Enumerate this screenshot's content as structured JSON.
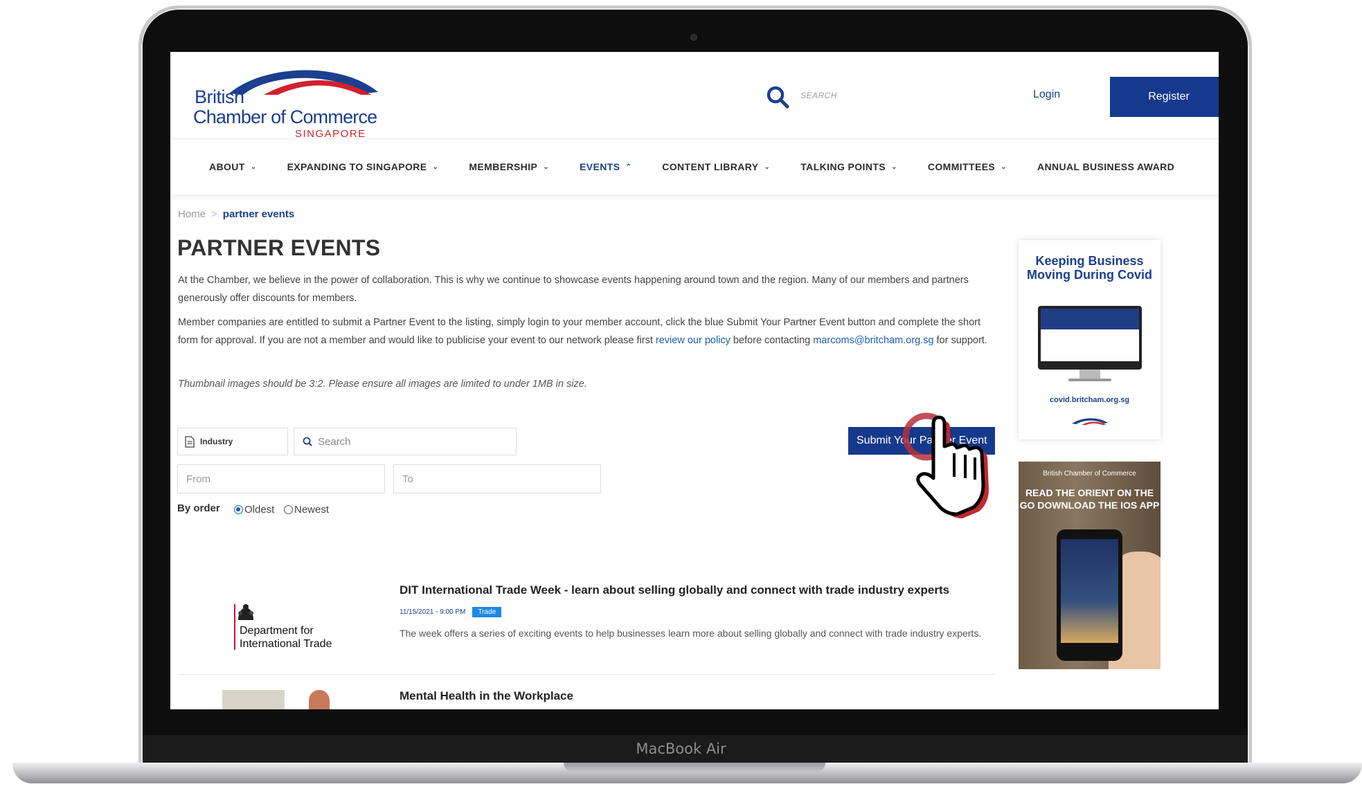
{
  "device": {
    "brand_label": "MacBook Air"
  },
  "header": {
    "logo": {
      "line1": "British",
      "line2": "Chamber of Commerce",
      "line3": "SINGAPORE"
    },
    "search_label": "SEARCH",
    "login_label": "Login",
    "register_label": "Register"
  },
  "nav": {
    "items": [
      {
        "label": "ABOUT"
      },
      {
        "label": "EXPANDING TO SINGAPORE"
      },
      {
        "label": "MEMBERSHIP"
      },
      {
        "label": "EVENTS"
      },
      {
        "label": "CONTENT LIBRARY"
      },
      {
        "label": "TALKING POINTS"
      },
      {
        "label": "COMMITTEES"
      },
      {
        "label": "ANNUAL BUSINESS AWARD"
      }
    ],
    "active": "EVENTS"
  },
  "breadcrumb": {
    "home": "Home",
    "separator": ">",
    "current": "partner events"
  },
  "page": {
    "title": "PARTNER EVENTS",
    "para1": "At the Chamber, we believe in the power of collaboration. This is why we continue to showcase events happening around town and the region. Many of our members and partners generously offer discounts for members.",
    "para2_a": "Member companies are entitled to submit a Partner Event to the listing, simply login to your member account, click the blue Submit Your Partner Event button and complete the short form for approval. If you are not a member and would like to publicise your event to our network please first ",
    "para2_link": "review our policy",
    "para2_b": " before contacting ",
    "para2_email": "marcoms@britcham.org.sg",
    "para2_c": " for support.",
    "para3": "Thumbnail images should be 3:2. Please ensure all images are limited to under 1MB in size."
  },
  "filters": {
    "industry_label": "Industry",
    "search_placeholder": "Search",
    "from_placeholder": "From",
    "to_placeholder": "To",
    "order_label": "By order",
    "order_options": [
      "Oldest",
      "Newest"
    ],
    "order_selected": "Oldest"
  },
  "submit_button_label": "Submit Your Partner Event",
  "events": [
    {
      "thumb_org_line1": "Department for",
      "thumb_org_line2": "International Trade",
      "title": "DIT International Trade Week - learn about selling globally and connect with trade industry experts",
      "date": "11/15/2021 - 9:00 PM",
      "tag": "Trade",
      "description": "The week offers a series of exciting events to help businesses learn more about selling globally and connect with trade industry experts."
    },
    {
      "title": "Mental Health in the Workplace"
    }
  ],
  "ads": {
    "covid_title": "Keeping Business Moving During Covid",
    "covid_url": "covid.britcham.org.sg",
    "app_brand": "British Chamber of Commerce",
    "app_text": "READ THE ORIENT ON THE GO DOWNLOAD THE IOS APP"
  },
  "colors": {
    "brand_blue": "#15398c",
    "brand_red": "#d0222b",
    "tag_blue": "#1e88e5"
  }
}
